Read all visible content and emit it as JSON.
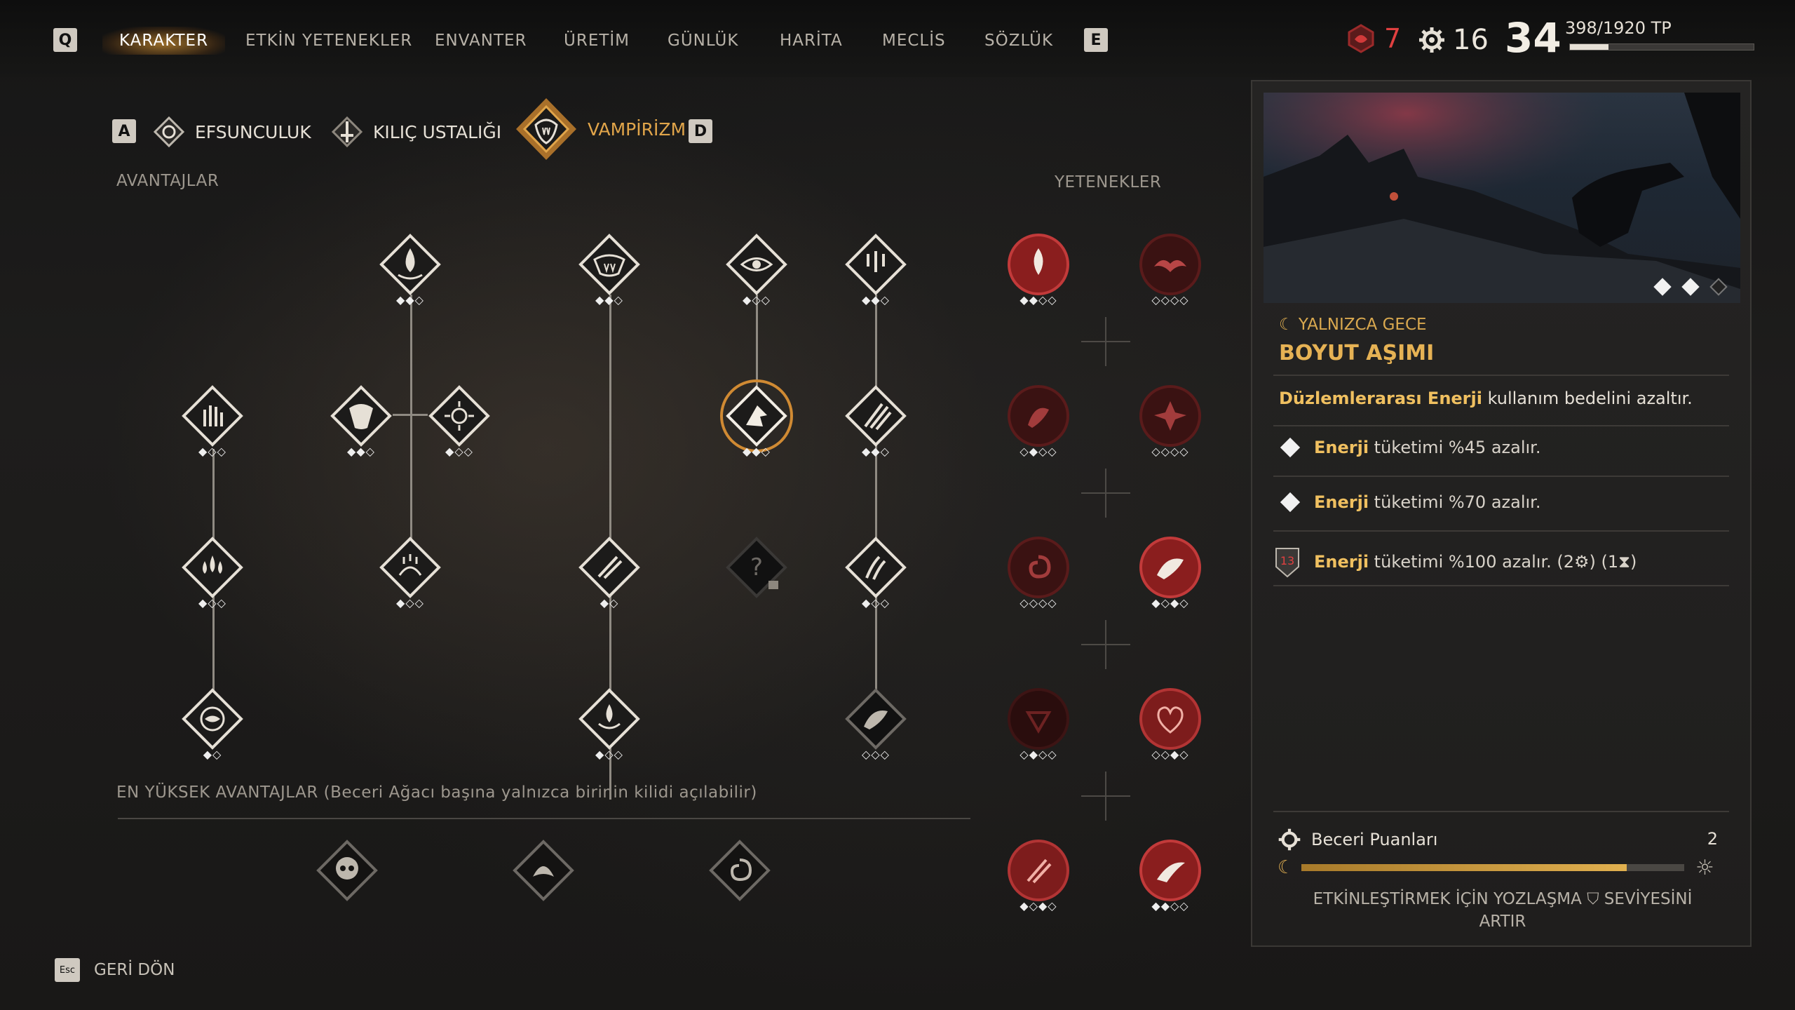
{
  "nav": {
    "left_key": "Q",
    "right_key": "E",
    "tabs": [
      "KARAKTER",
      "ETKİN YETENEKLER",
      "ENVANTER",
      "ÜRETİM",
      "GÜNLÜK",
      "HARİTA",
      "MECLİS",
      "SÖZLÜK"
    ],
    "active_tab": "KARAKTER"
  },
  "stats": {
    "corruption": "7",
    "skill_points": "16",
    "level": "34",
    "xp_text": "398/1920 TP",
    "xp_fraction": 0.21
  },
  "trees": {
    "left_key": "A",
    "right_key": "D",
    "tabs": [
      {
        "label": "EFSUNCULUK",
        "icon": "sorcery-icon"
      },
      {
        "label": "KILIÇ USTALIĞI",
        "icon": "sword-icon"
      },
      {
        "label": "VAMPİRİZM",
        "icon": "vampirism-icon"
      }
    ],
    "active": "VAMPİRİZM"
  },
  "labels": {
    "perks": "AVANTAJLAR",
    "abilities": "YETENEKLER",
    "ultimate_perks": "EN YÜKSEK AVANTAJLAR (Beceri Ağacı başına yalnızca birinin kilidi açılabilir)"
  },
  "detail": {
    "condition": "☾ YALNIZCA GECE",
    "title": "BOYUT AŞIMI",
    "description_highlight": "Düzlemlerarası Enerji",
    "description_rest": " kullanım bedelini azaltır.",
    "effects": [
      {
        "keyword": "Enerji",
        "text": " tüketimi %45 azalır.",
        "icon": "diamond-icon"
      },
      {
        "keyword": "Enerji",
        "text": " tüketimi %70 azalır.",
        "icon": "diamond-icon"
      },
      {
        "keyword": "Enerji",
        "text": " tüketimi %100 azalır.  (2",
        "suffix1": ") (1",
        "suffix2": ")",
        "icon": "corruption-13-icon",
        "badge": "13"
      }
    ],
    "skill_points_label": "Beceri Puanları",
    "skill_points_value": "2",
    "unlock_line1": "ETKİNLEŞTİRMEK İÇİN YOZLAŞMA",
    "unlock_line1b": "SEVİYESİNİ",
    "unlock_line2": "ARTIR",
    "corruption_bar_fraction": 0.85
  },
  "footer": {
    "key": "Esc",
    "label": "GERİ DÖN"
  }
}
